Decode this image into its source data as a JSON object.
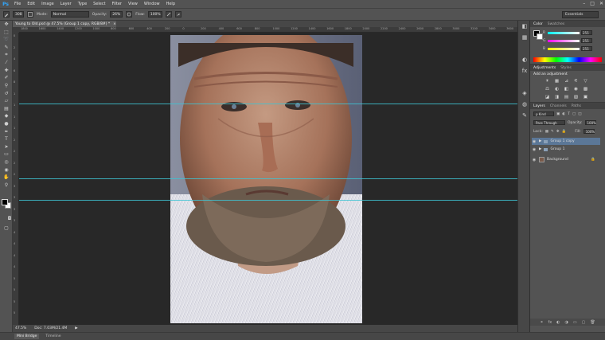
{
  "app": {
    "logo": "Ps",
    "menu": [
      "File",
      "Edit",
      "Image",
      "Layer",
      "Type",
      "Select",
      "Filter",
      "View",
      "Window",
      "Help"
    ],
    "window_controls": [
      "–",
      "□",
      "✕"
    ]
  },
  "options_bar": {
    "brush_size": "308",
    "mode_label": "Mode:",
    "mode_value": "Normal",
    "opacity_label": "Opacity:",
    "opacity_value": "26%",
    "flow_label": "Flow:",
    "flow_value": "100%",
    "workspace": "Essentials"
  },
  "document": {
    "tab_title": "Young to Old.psd @ 47.5% (Group 1 copy, RGB/8#) *",
    "tab_close": "×"
  },
  "rulers": {
    "horizontal": [
      "1800",
      "1600",
      "1400",
      "1200",
      "1000",
      "800",
      "600",
      "400",
      "200",
      "0",
      "200",
      "400",
      "600",
      "800",
      "1000",
      "1200",
      "1400",
      "1600",
      "1800",
      "2000",
      "2200",
      "2400",
      "2600",
      "2800",
      "3000",
      "3200",
      "3400",
      "3600"
    ],
    "vertical": [
      "0",
      "2",
      "4",
      "6",
      "8",
      "1",
      "1",
      "1",
      "1",
      "2",
      "2",
      "2",
      "2",
      "3",
      "3",
      "3",
      "3",
      "4",
      "4",
      "4",
      "4",
      "5",
      "5",
      "5",
      "5"
    ]
  },
  "status": {
    "zoom": "47.5%",
    "doc_info": "Doc: 7.03M/21.4M"
  },
  "bottom_tabs": [
    "Mini Bridge",
    "Timeline"
  ],
  "color_panel": {
    "tabs": [
      "Color",
      "Swatches"
    ],
    "channels": [
      {
        "name": "R",
        "value": "255",
        "color": "#ff4040"
      },
      {
        "name": "G",
        "value": "255",
        "color": "#40ff40"
      },
      {
        "name": "B",
        "value": "255",
        "color": "#4060ff"
      }
    ]
  },
  "adjustments_panel": {
    "tabs": [
      "Adjustments",
      "Styles"
    ],
    "title": "Add an adjustment",
    "icons": [
      "☀",
      "▦",
      "⊿",
      "⚟",
      "▽",
      "⚖",
      "◐",
      "◧",
      "◉",
      "▩",
      "◪",
      "◨",
      "▤",
      "▧",
      "▣"
    ]
  },
  "layers_panel": {
    "tabs": [
      "Layers",
      "Channels",
      "Paths"
    ],
    "kind_label": "ρ Kind",
    "blend_mode": "Pass Through",
    "opacity_label": "Opacity:",
    "opacity_value": "100%",
    "lock_label": "Lock:",
    "fill_label": "Fill:",
    "fill_value": "100%",
    "layers": [
      {
        "name": "Group 1 copy",
        "type": "group",
        "selected": true
      },
      {
        "name": "Group 1",
        "type": "group",
        "selected": false
      },
      {
        "name": "Background",
        "type": "pixel",
        "selected": false
      }
    ],
    "footer_icons": [
      "⚭",
      "fx",
      "◐",
      "◑",
      "▭",
      "▢",
      "🗑"
    ]
  },
  "dock_icons": [
    "color-icon",
    "swatches-icon",
    "adjustments-icon",
    "styles-icon",
    "layers-icon",
    "channels-icon",
    "paths-icon"
  ]
}
